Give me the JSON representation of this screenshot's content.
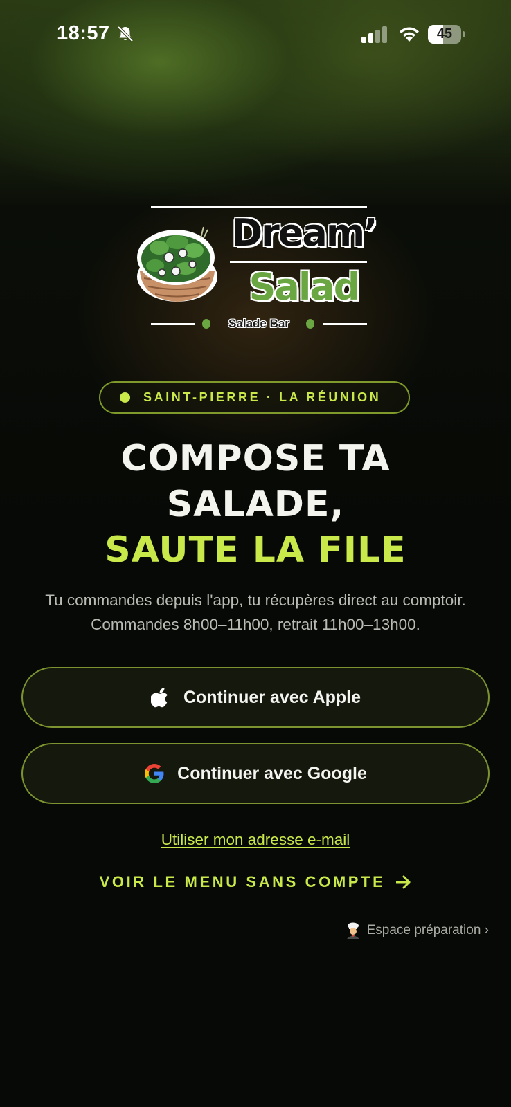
{
  "status_bar": {
    "time": "18:57",
    "battery_percent": "45",
    "battery_level": 0.45
  },
  "logo": {
    "word_top": "Dream’",
    "word_bottom": "Salad",
    "subtitle": "Salade Bar",
    "colors": {
      "green": "#6aa641",
      "white": "#ffffff"
    }
  },
  "location": {
    "label": "SAINT-PIERRE · LA RÉUNION"
  },
  "headline": {
    "line1": "COMPOSE TA",
    "line2": "SALADE,",
    "line3": "SAUTE LA FILE"
  },
  "description": "Tu commandes depuis l'app, tu récupères direct au comptoir. Commandes 8h00–11h00, retrait 11h00–13h00.",
  "auth": {
    "apple_label": "Continuer avec Apple",
    "google_label": "Continuer avec Google",
    "email_link": "Utiliser mon adresse e-mail"
  },
  "guest_link": "VOIR LE MENU SANS COMPTE",
  "prep_link": "Espace préparation ›",
  "theme": {
    "accent": "#c9e84a",
    "border": "#7c9330",
    "background": "#070906",
    "button_bg": "#15180d"
  },
  "icons": [
    "bell-slash-icon",
    "signal-icon",
    "wifi-icon",
    "battery-icon",
    "salad-bowl-icon",
    "apple-icon",
    "google-icon",
    "arrow-right-icon",
    "chef-icon"
  ]
}
